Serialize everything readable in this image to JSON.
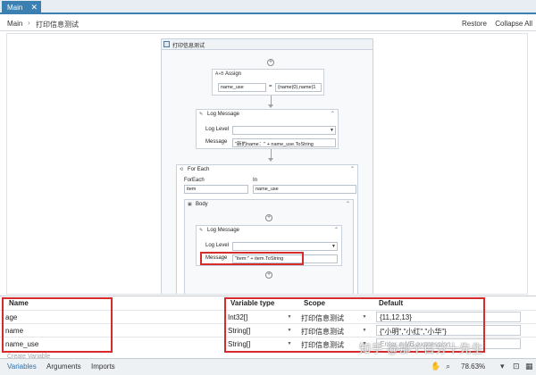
{
  "tabs": {
    "main_tab": "Main",
    "close_glyph": "✕"
  },
  "breadcrumb": {
    "root": "Main",
    "separator": "›",
    "current": "打印信息测试"
  },
  "designer_actions": {
    "restore": "Restore",
    "collapse_all": "Collapse All"
  },
  "sequence": {
    "title": "打印信息测试",
    "assign": {
      "type_glyph": "A+B",
      "title": "Assign",
      "to": "name_use",
      "equals": "=",
      "value": "{name(0),name(1"
    },
    "log_message_1": {
      "title": "Log Message",
      "level_label": "Log Level",
      "level_value": "",
      "message_label": "Message",
      "message_value": "\"新的name：\" + name_use.ToString"
    },
    "for_each": {
      "title": "For Each",
      "foreach_label": "ForEach",
      "foreach_value": "item",
      "in_label": "In",
      "in_value": "name_use",
      "body": {
        "title": "Body",
        "log_message": {
          "title": "Log Message",
          "level_label": "Log Level",
          "level_value": "",
          "message_label": "Message",
          "message_value": "\"item:\" + item.ToString"
        }
      }
    }
  },
  "variables": {
    "columns": {
      "name": "Name",
      "variable_type": "Variable type",
      "scope": "Scope",
      "default": "Default"
    },
    "rows": [
      {
        "name": "age",
        "type": "Int32[]",
        "scope": "打印信息测试",
        "default": "{11,12,13}"
      },
      {
        "name": "name",
        "type": "String[]",
        "scope": "打印信息测试",
        "default": "{\"小明\",\"小红\",\"小华\"}"
      },
      {
        "name": "name_use",
        "type": "String[]",
        "scope": "打印信息测试",
        "default": "Enter a VB expression"
      }
    ],
    "create_variable": "Create Variable"
  },
  "bottom_tabs": {
    "variables": "Variables",
    "arguments": "Arguments",
    "imports": "Imports"
  },
  "status": {
    "zoom": "78.63%"
  },
  "watermark": "知乎 @那个百分十先生",
  "colors": {
    "accent": "#3c7fb1",
    "highlight_red": "#d62b2b"
  }
}
